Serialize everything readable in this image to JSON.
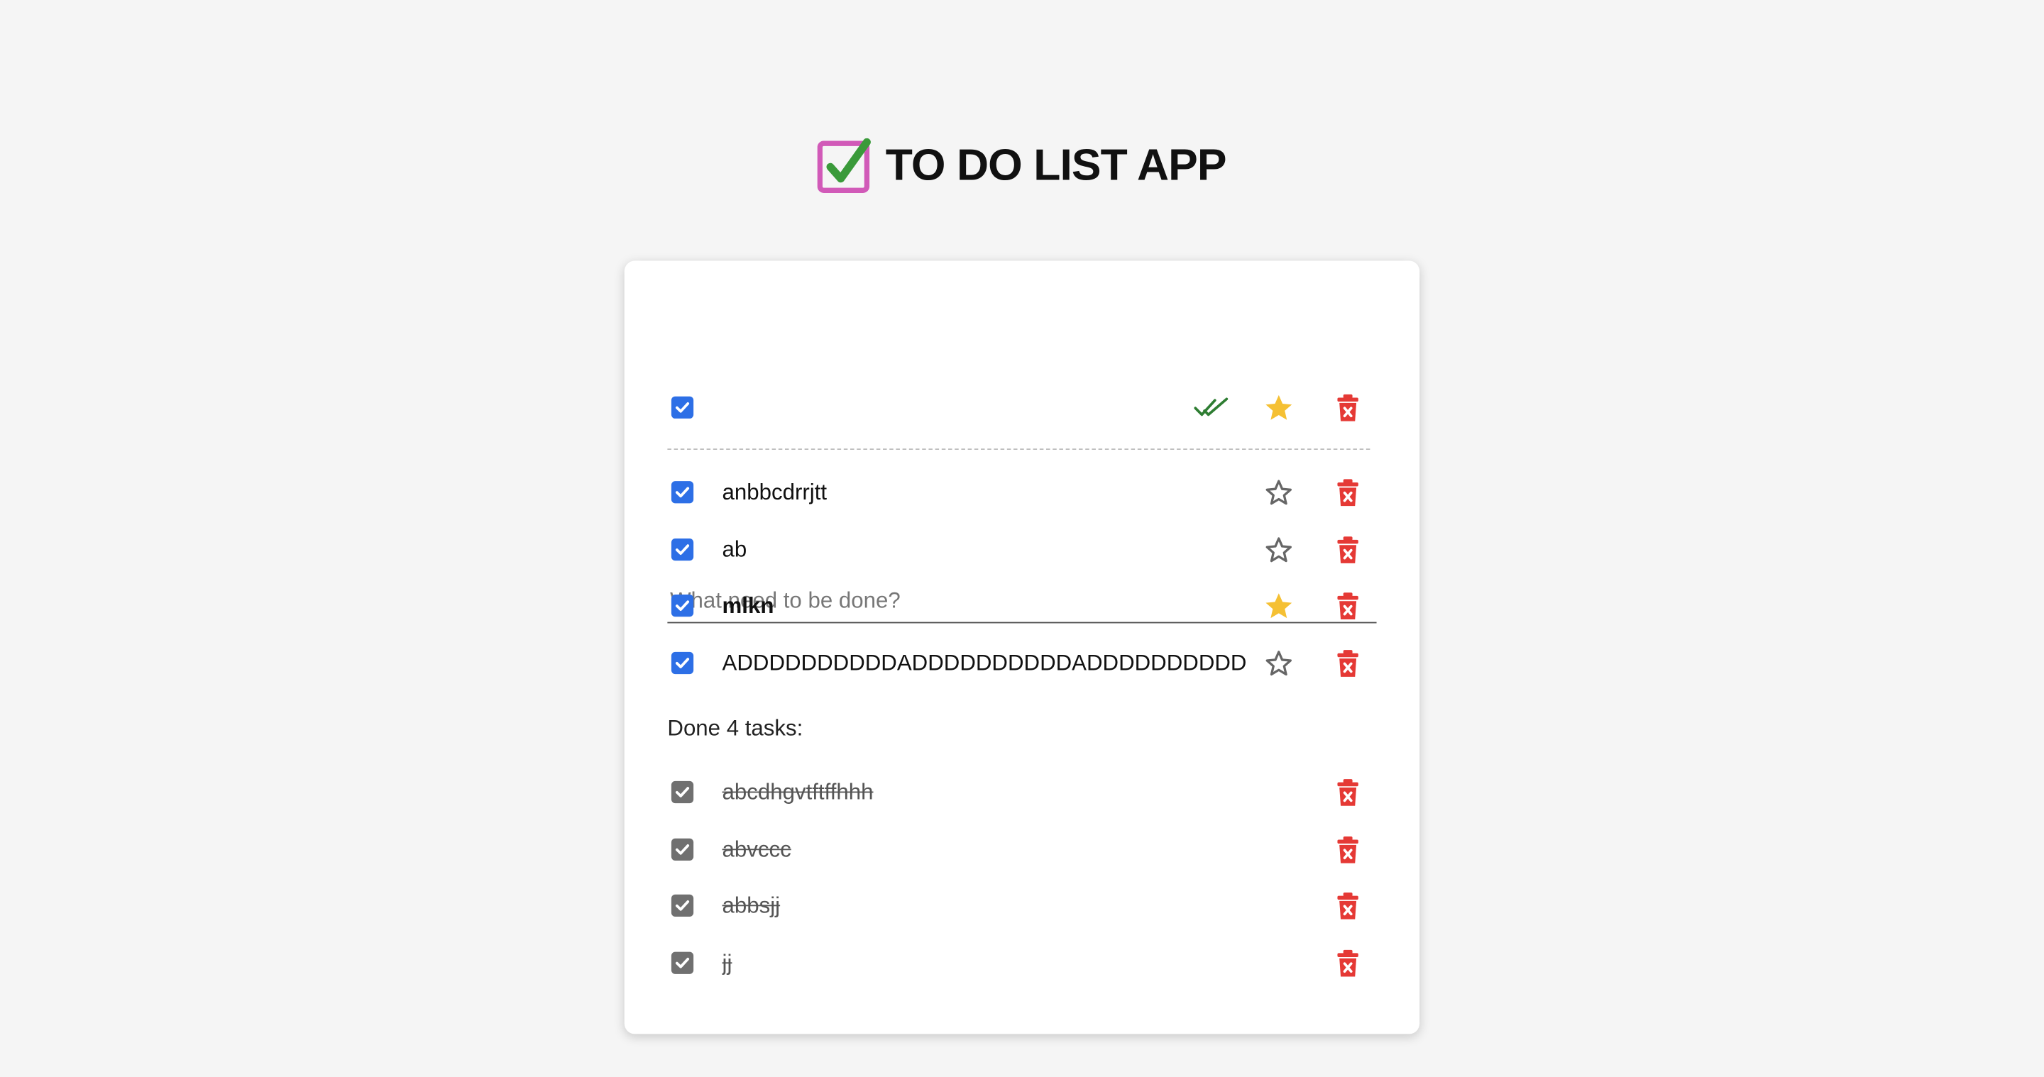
{
  "app": {
    "title": "TO DO LIST APP",
    "logo_icon": "checked-box-icon"
  },
  "new_task": {
    "placeholder": "What need to be done?",
    "value": ""
  },
  "toolbar": {
    "select_all_checked": true,
    "mark_done_icon": "double-check-icon",
    "star_icon": "star-filled-icon",
    "delete_icon": "trash-icon"
  },
  "active_tasks": [
    {
      "text": "anbbcdrrjtt",
      "checked": true,
      "starred": false,
      "bold": false
    },
    {
      "text": "ab",
      "checked": true,
      "starred": false,
      "bold": false
    },
    {
      "text": "mlkn",
      "checked": true,
      "starred": true,
      "bold": true
    },
    {
      "text": "ADDDDDDDDDDADDDDDDDDDDADDDDDDDDDD",
      "checked": true,
      "starred": false,
      "bold": false
    }
  ],
  "done_section": {
    "heading": "Done 4 tasks:"
  },
  "done_tasks": [
    {
      "text": "abcdhgvtftffhhh",
      "checked": true
    },
    {
      "text": "abvccc",
      "checked": true
    },
    {
      "text": "abbsjj",
      "checked": true
    },
    {
      "text": "jj",
      "checked": true
    }
  ],
  "colors": {
    "background": "#f5f5f5",
    "card": "#ffffff",
    "checkbox_active": "#2d6fe6",
    "checkbox_done": "#707070",
    "star_filled": "#f5c033",
    "star_outline": "#666666",
    "trash": "#e53935",
    "double_check": "#2e7d32",
    "logo_box": "#d15ab8",
    "logo_check": "#3a9a3a"
  }
}
